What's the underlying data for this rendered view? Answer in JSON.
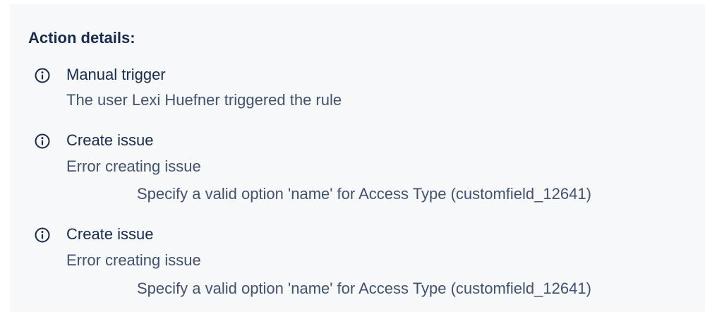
{
  "heading": "Action details:",
  "actions": [
    {
      "icon": "info-icon",
      "title": "Manual trigger",
      "description": "The user Lexi Huefner triggered the rule",
      "detail": ""
    },
    {
      "icon": "info-icon",
      "title": "Create issue",
      "description": "Error creating issue",
      "detail": "Specify a valid option 'name' for Access Type (customfield_12641)"
    },
    {
      "icon": "info-icon",
      "title": "Create issue",
      "description": "Error creating issue",
      "detail": "Specify a valid option 'name' for Access Type (customfield_12641)"
    }
  ],
  "colors": {
    "panel_background": "#f7f8f9",
    "title_text": "#172b4d",
    "secondary_text": "#42526e"
  }
}
